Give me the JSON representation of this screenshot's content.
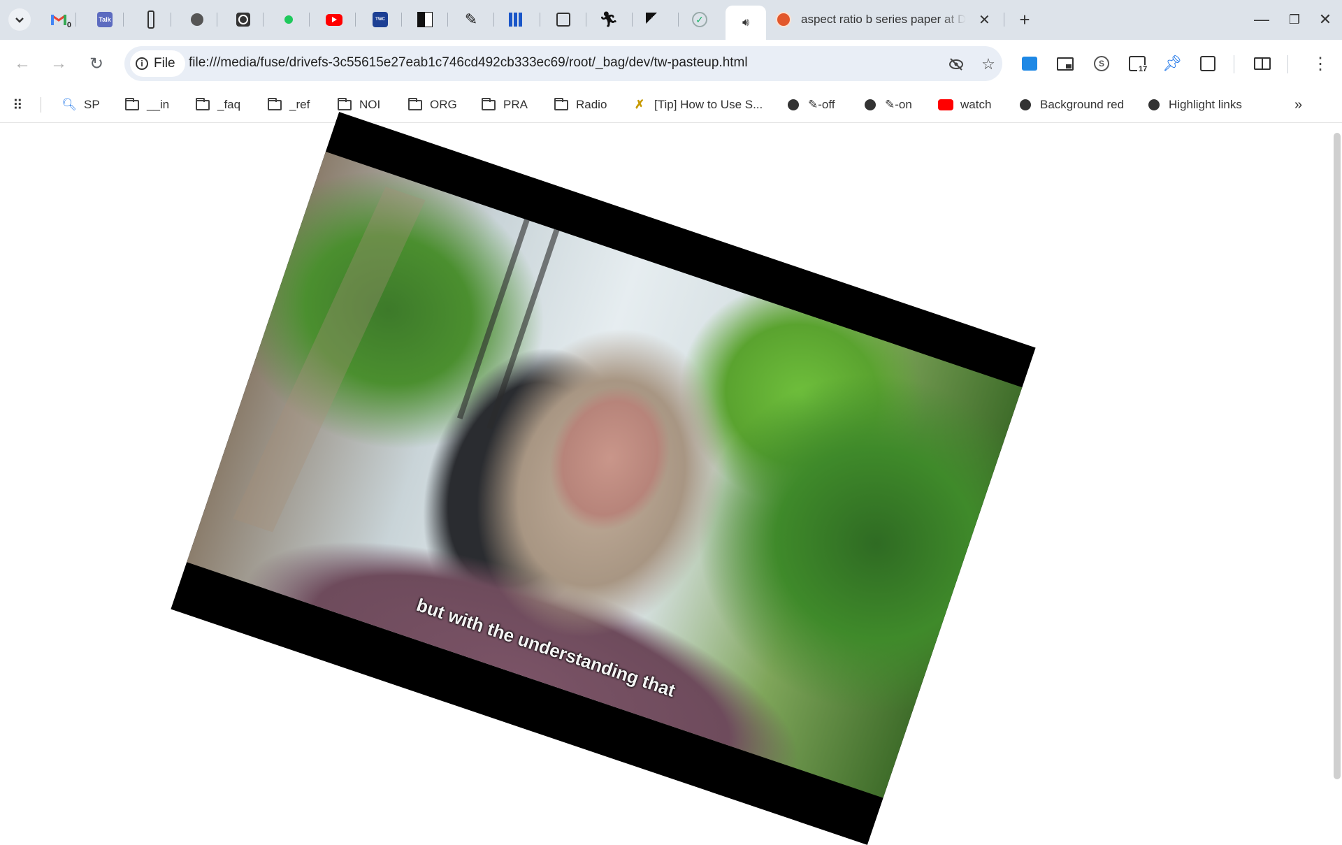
{
  "tabs": {
    "pinned_icons": [
      "gmail-icon",
      "talk-icon",
      "tool-icon",
      "globe-icon",
      "camera-icon",
      "green-dot-icon",
      "youtube-icon",
      "weather-channel-icon",
      "checker-icon",
      "pen-icon",
      "grid-icon",
      "search-copy-icon",
      "runner-icon",
      "worker-icon",
      "check-circle-icon"
    ],
    "gmail_badge": "0",
    "active_title": "aspect ratio b series paper at Du",
    "new_tab": "+"
  },
  "toolbar": {
    "url_chip": "File",
    "url": "file:///media/fuse/drivefs-3c55615e27eab1c746cd492cb333ec69/root/_bag/dev/tw-pasteup.html",
    "ext_badge": "17"
  },
  "bookmarks": {
    "items": [
      {
        "label": "SP",
        "icon": "search-icon"
      },
      {
        "label": "__in",
        "icon": "folder-icon"
      },
      {
        "label": "_faq",
        "icon": "folder-icon"
      },
      {
        "label": "_ref",
        "icon": "folder-icon"
      },
      {
        "label": "NOI",
        "icon": "folder-icon"
      },
      {
        "label": "ORG",
        "icon": "folder-icon"
      },
      {
        "label": "PRA",
        "icon": "folder-icon"
      },
      {
        "label": "Radio",
        "icon": "folder-icon"
      },
      {
        "label": "[Tip] How to Use S...",
        "icon": "tip-icon"
      },
      {
        "label": "✎-off",
        "icon": "github-icon"
      },
      {
        "label": "✎-on",
        "icon": "github-icon"
      },
      {
        "label": "watch",
        "icon": "youtube-icon"
      },
      {
        "label": "Background red",
        "icon": "github-icon"
      },
      {
        "label": "Highlight links",
        "icon": "github-icon"
      }
    ]
  },
  "video": {
    "subtitle": "but with the understanding that"
  },
  "colors": {
    "tabstrip": "#dde3ea",
    "omnibox": "#e9eef6",
    "youtube_red": "#ff0000"
  }
}
